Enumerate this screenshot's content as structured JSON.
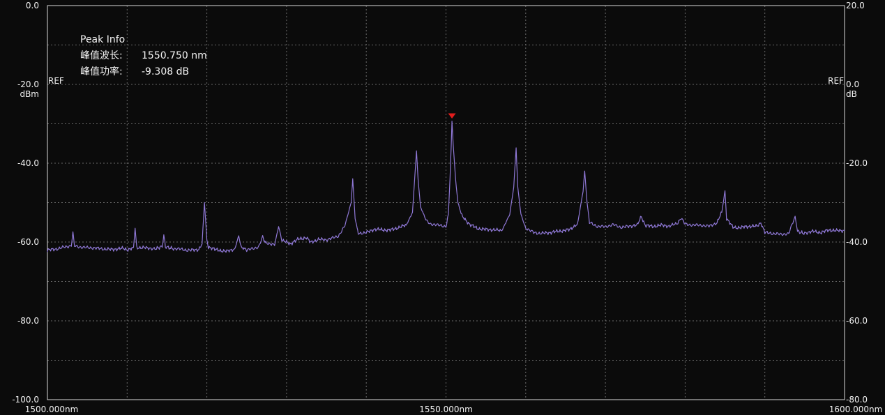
{
  "chart_data": {
    "type": "line",
    "x_unit_label": "nm",
    "x_ticks": [
      "1500.000nm",
      "1550.000nm",
      "1600.000nm"
    ],
    "xlim": [
      1500,
      1600
    ],
    "left_axis": {
      "unit_label": "dBm",
      "ylim": [
        -100,
        0
      ],
      "tick_values": [
        0,
        -20,
        -40,
        -60,
        -80,
        -100
      ],
      "tick_labels": [
        "0.0",
        "-20.0",
        "-40.0",
        "-60.0",
        "-80.0",
        "-100.0"
      ]
    },
    "right_axis": {
      "unit_label": "dB",
      "ylim": [
        -80,
        20
      ],
      "tick_values": [
        20,
        0,
        -20,
        -40,
        -60,
        -80
      ],
      "tick_labels": [
        "20.0",
        "0.0",
        "-20.0",
        "-40.0",
        "-60.0",
        "-80.0"
      ]
    },
    "ref_label": "REF",
    "ref_level_dBm": -20,
    "grid": true,
    "series": [
      {
        "color": "#8f78d6",
        "points": [
          [
            1500.0,
            -62.0
          ],
          [
            1501.5,
            -61.6
          ],
          [
            1503.0,
            -61.0
          ],
          [
            1503.2,
            -57.5
          ],
          [
            1503.4,
            -61.0
          ],
          [
            1505.0,
            -61.4
          ],
          [
            1506.5,
            -61.7
          ],
          [
            1508.0,
            -61.8
          ],
          [
            1509.5,
            -61.7
          ],
          [
            1510.0,
            -62.0
          ],
          [
            1510.8,
            -61.5
          ],
          [
            1511.0,
            -56.5
          ],
          [
            1511.2,
            -61.3
          ],
          [
            1512.0,
            -61.4
          ],
          [
            1513.5,
            -61.8
          ],
          [
            1514.4,
            -61.0
          ],
          [
            1514.6,
            -58.2
          ],
          [
            1514.8,
            -61.2
          ],
          [
            1516.0,
            -61.7
          ],
          [
            1517.5,
            -62.1
          ],
          [
            1519.0,
            -61.8
          ],
          [
            1519.4,
            -60.5
          ],
          [
            1519.7,
            -50.0
          ],
          [
            1520.0,
            -59.5
          ],
          [
            1520.2,
            -61.3
          ],
          [
            1521.0,
            -61.9
          ],
          [
            1522.5,
            -62.3
          ],
          [
            1523.5,
            -61.8
          ],
          [
            1524.0,
            -58.5
          ],
          [
            1524.3,
            -61.4
          ],
          [
            1525.0,
            -62.0
          ],
          [
            1526.5,
            -61.2
          ],
          [
            1527.0,
            -58.8
          ],
          [
            1527.4,
            -60.2
          ],
          [
            1528.5,
            -60.8
          ],
          [
            1529.0,
            -56.0
          ],
          [
            1529.4,
            -59.5
          ],
          [
            1530.5,
            -60.5
          ],
          [
            1531.5,
            -59.3
          ],
          [
            1532.5,
            -58.8
          ],
          [
            1533.0,
            -60.0
          ],
          [
            1534.0,
            -59.4
          ],
          [
            1535.0,
            -59.5
          ],
          [
            1536.5,
            -58.4
          ],
          [
            1537.3,
            -56.0
          ],
          [
            1538.1,
            -50.0
          ],
          [
            1538.3,
            -44.0
          ],
          [
            1538.6,
            -54.0
          ],
          [
            1539.0,
            -57.8
          ],
          [
            1540.0,
            -57.5
          ],
          [
            1541.0,
            -56.8
          ],
          [
            1542.0,
            -57.0
          ],
          [
            1543.0,
            -56.9
          ],
          [
            1544.0,
            -56.3
          ],
          [
            1545.0,
            -55.8
          ],
          [
            1545.8,
            -52.5
          ],
          [
            1546.1,
            -43.0
          ],
          [
            1546.3,
            -37.0
          ],
          [
            1546.5,
            -44.0
          ],
          [
            1546.8,
            -51.0
          ],
          [
            1547.5,
            -54.5
          ],
          [
            1548.0,
            -55.4
          ],
          [
            1549.0,
            -55.8
          ],
          [
            1550.0,
            -56.0
          ],
          [
            1550.3,
            -53.0
          ],
          [
            1550.5,
            -44.0
          ],
          [
            1550.65,
            -36.0
          ],
          [
            1550.75,
            -29.3
          ],
          [
            1550.9,
            -35.0
          ],
          [
            1551.2,
            -44.0
          ],
          [
            1551.5,
            -50.0
          ],
          [
            1552.0,
            -53.5
          ],
          [
            1553.0,
            -55.6
          ],
          [
            1554.0,
            -56.5
          ],
          [
            1555.0,
            -56.8
          ],
          [
            1556.0,
            -57.0
          ],
          [
            1557.0,
            -57.1
          ],
          [
            1558.0,
            -53.0
          ],
          [
            1558.5,
            -46.0
          ],
          [
            1558.8,
            -36.0
          ],
          [
            1559.0,
            -46.0
          ],
          [
            1559.4,
            -53.0
          ],
          [
            1560.0,
            -56.5
          ],
          [
            1561.0,
            -57.5
          ],
          [
            1562.0,
            -57.8
          ],
          [
            1563.0,
            -57.7
          ],
          [
            1564.5,
            -57.1
          ],
          [
            1565.5,
            -56.8
          ],
          [
            1566.5,
            -55.5
          ],
          [
            1567.2,
            -47.0
          ],
          [
            1567.4,
            -42.0
          ],
          [
            1567.7,
            -50.0
          ],
          [
            1568.0,
            -55.0
          ],
          [
            1569.0,
            -56.0
          ],
          [
            1570.0,
            -56.2
          ],
          [
            1571.0,
            -55.6
          ],
          [
            1572.0,
            -56.2
          ],
          [
            1573.0,
            -56.0
          ],
          [
            1574.0,
            -55.8
          ],
          [
            1574.5,
            -53.5
          ],
          [
            1575.0,
            -55.7
          ],
          [
            1576.0,
            -56.0
          ],
          [
            1577.0,
            -55.8
          ],
          [
            1578.0,
            -56.0
          ],
          [
            1579.0,
            -55.2
          ],
          [
            1579.5,
            -53.8
          ],
          [
            1580.0,
            -55.5
          ],
          [
            1581.0,
            -55.8
          ],
          [
            1582.0,
            -55.7
          ],
          [
            1583.0,
            -55.9
          ],
          [
            1584.0,
            -55.2
          ],
          [
            1584.6,
            -52.5
          ],
          [
            1585.0,
            -47.0
          ],
          [
            1585.2,
            -54.0
          ],
          [
            1586.0,
            -56.2
          ],
          [
            1587.0,
            -56.3
          ],
          [
            1588.0,
            -56.1
          ],
          [
            1589.0,
            -56.0
          ],
          [
            1589.5,
            -55.0
          ],
          [
            1590.0,
            -57.5
          ],
          [
            1591.0,
            -57.9
          ],
          [
            1592.0,
            -58.1
          ],
          [
            1593.0,
            -57.8
          ],
          [
            1593.5,
            -55.0
          ],
          [
            1593.8,
            -53.5
          ],
          [
            1594.1,
            -57.2
          ],
          [
            1595.0,
            -57.8
          ],
          [
            1596.0,
            -57.3
          ],
          [
            1597.0,
            -57.5
          ],
          [
            1598.0,
            -57.0
          ],
          [
            1599.0,
            -57.2
          ],
          [
            1600.0,
            -57.0
          ]
        ]
      }
    ],
    "peak_marker": {
      "x": 1550.75,
      "y": -29.3,
      "color": "#e11d1d"
    }
  },
  "peak_info": {
    "title": "Peak Info",
    "wavelength_label": "峰值波长:",
    "wavelength_value": "1550.750 nm",
    "power_label": "峰值功率:",
    "power_value": "-9.308 dB"
  },
  "colors": {
    "background": "#0b0b0b",
    "border": "#d9d9d9",
    "grid": "#8a8a8a",
    "text": "#f2f2f2"
  }
}
